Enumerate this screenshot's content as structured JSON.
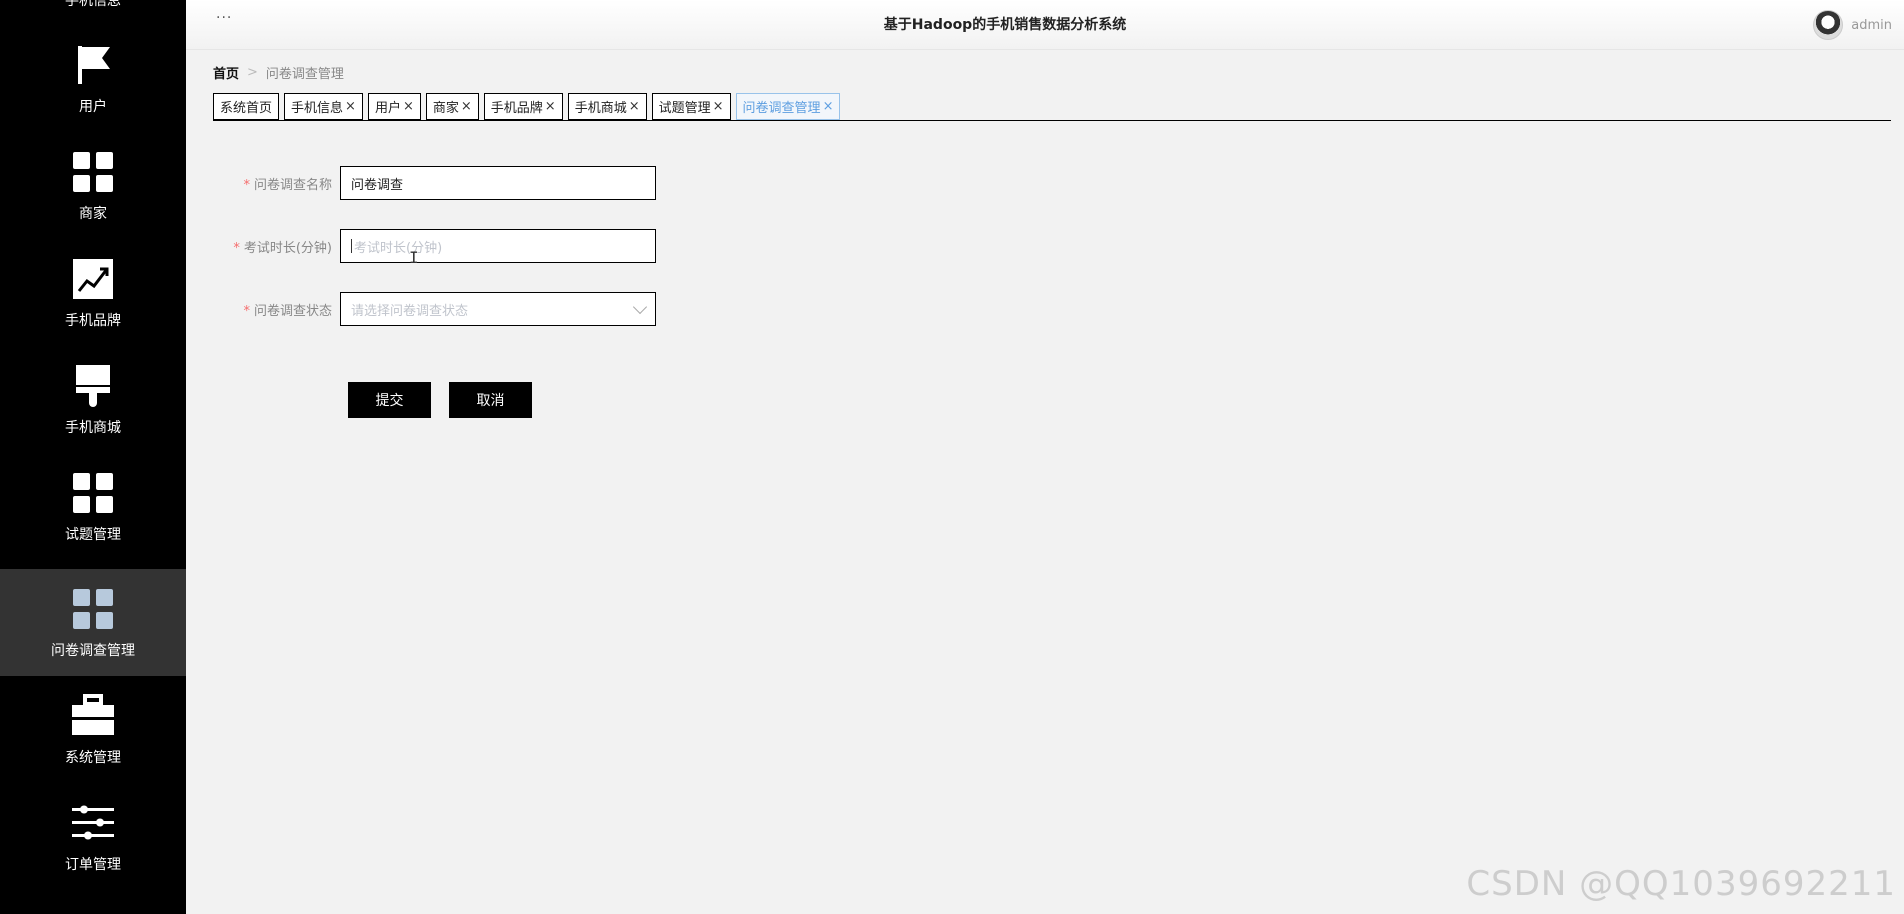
{
  "sidebar": {
    "partial_top_label": "手机信息",
    "items": [
      {
        "label": "用户",
        "icon": "flag-icon"
      },
      {
        "label": "商家",
        "icon": "grid-icon"
      },
      {
        "label": "手机品牌",
        "icon": "chart-line-icon"
      },
      {
        "label": "手机商城",
        "icon": "brush-icon"
      },
      {
        "label": "试题管理",
        "icon": "grid-icon"
      },
      {
        "label": "问卷调查管理",
        "icon": "grid-icon",
        "active": true
      },
      {
        "label": "系统管理",
        "icon": "briefcase-icon"
      },
      {
        "label": "订单管理",
        "icon": "sliders-icon"
      }
    ]
  },
  "header": {
    "dots": "···",
    "title": "基于Hadoop的手机销售数据分析系统",
    "username": "admin"
  },
  "breadcrumb": {
    "home": "首页",
    "separator": ">",
    "current": "问卷调查管理"
  },
  "tabs": [
    {
      "label": "系统首页",
      "closable": false
    },
    {
      "label": "手机信息",
      "closable": true
    },
    {
      "label": "用户",
      "closable": true
    },
    {
      "label": "商家",
      "closable": true
    },
    {
      "label": "手机品牌",
      "closable": true
    },
    {
      "label": "手机商城",
      "closable": true
    },
    {
      "label": "试题管理",
      "closable": true
    },
    {
      "label": "问卷调查管理",
      "closable": true,
      "active": true
    }
  ],
  "form": {
    "name_label": "问卷调查名称",
    "name_value": "问卷调查",
    "duration_label": "考试时长(分钟)",
    "duration_placeholder": "考试时长(分钟)",
    "status_label": "问卷调查状态",
    "status_placeholder": "请选择问卷调查状态",
    "required_mark": "*",
    "submit_label": "提交",
    "cancel_label": "取消"
  },
  "watermark": "CSDN @QQ1039692211",
  "colors": {
    "sidebar_bg": "#000000",
    "sidebar_active_bg": "#333333",
    "active_tab": "#5d9ee0",
    "required": "#f56c6c",
    "button_bg": "#000000"
  }
}
